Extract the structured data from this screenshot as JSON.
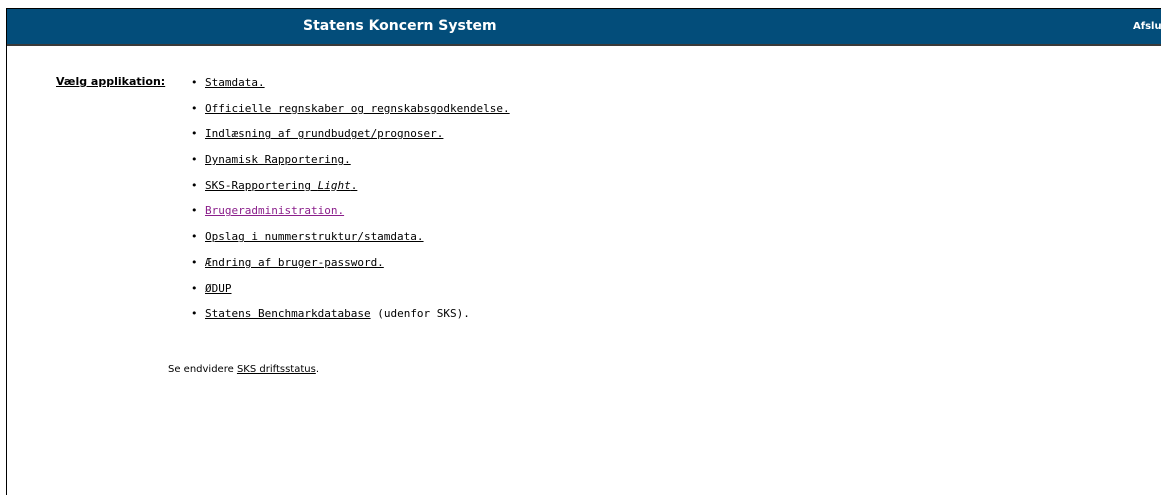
{
  "header": {
    "title": "Statens Koncern System",
    "exit_label": "Afslut"
  },
  "main": {
    "choose_label": "Vælg applikation:",
    "apps": [
      {
        "label": "Stamdata.",
        "suffix": "",
        "visited": false
      },
      {
        "label": "Officielle regnskaber og regnskabsgodkendelse.",
        "suffix": "",
        "visited": false
      },
      {
        "label": "Indlæsning af grundbudget/prognoser.",
        "suffix": "",
        "visited": false
      },
      {
        "label": "Dynamisk Rapportering.",
        "suffix": "",
        "visited": false
      },
      {
        "label": "SKS-Rapportering ",
        "label_italic": "Light",
        "label_end": ".",
        "suffix": "",
        "visited": false
      },
      {
        "label": "Brugeradministration.",
        "suffix": "",
        "visited": true
      },
      {
        "label": "Opslag i nummerstruktur/stamdata.",
        "suffix": "",
        "visited": false
      },
      {
        "label": "Ændring af bruger-password.",
        "suffix": "",
        "visited": false
      },
      {
        "label": "ØDUP",
        "suffix": "",
        "visited": false
      },
      {
        "label": "Statens Benchmarkdatabase",
        "suffix": " (udenfor SKS).",
        "visited": false
      }
    ],
    "see_also_prefix": "Se endvidere ",
    "see_also_link": "SKS driftsstatus",
    "see_also_suffix": "."
  },
  "colors": {
    "header_bg": "#034d7a",
    "link": "#000000",
    "visited_link": "#8b1f8b"
  }
}
